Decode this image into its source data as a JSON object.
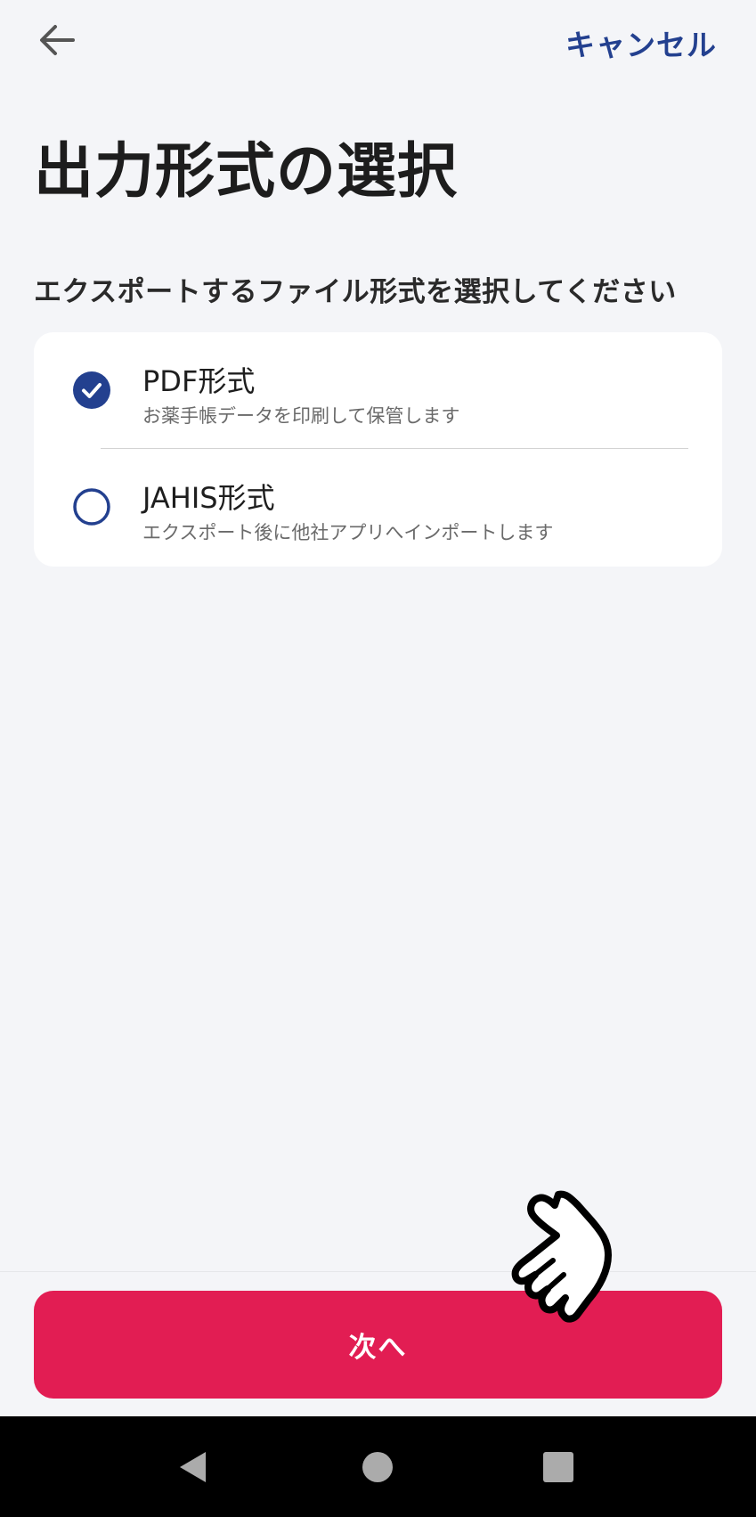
{
  "header": {
    "back_icon": "arrow-left-icon",
    "cancel_label": "キャンセル"
  },
  "page": {
    "title": "出力形式の選択",
    "instruction": "エクスポートするファイル形式を選択してください"
  },
  "options": [
    {
      "title": "PDF形式",
      "description": "お薬手帳データを印刷して保管します",
      "selected": true
    },
    {
      "title": "JAHIS形式",
      "description": "エクスポート後に他社アプリへインポートします",
      "selected": false
    }
  ],
  "next_button": {
    "label": "次へ"
  },
  "navbar": {
    "back_icon": "triangle-back-icon",
    "home_icon": "circle-home-icon",
    "recents_icon": "square-recents-icon"
  },
  "colors": {
    "accent_blue": "#23408f",
    "primary_button": "#e21d53",
    "background": "#f4f5f8"
  }
}
